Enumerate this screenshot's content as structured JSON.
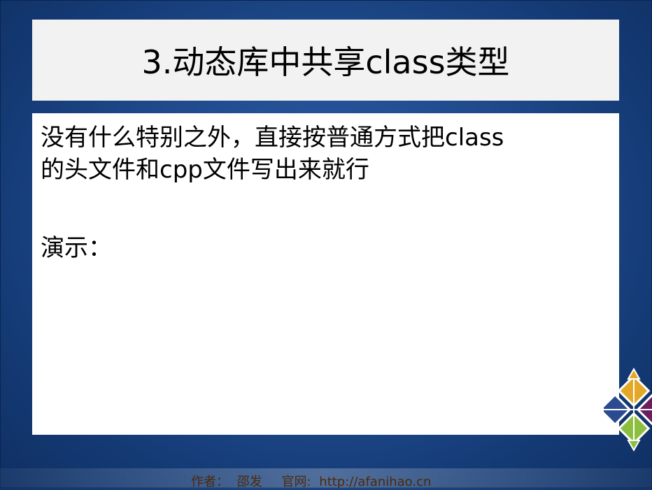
{
  "slide": {
    "title": "3.动态库中共享class类型",
    "body_line1": "没有什么特别之外，直接按普通方式把class",
    "body_line2": "的头文件和cpp文件写出来就行",
    "demo_label": "演示："
  },
  "footer": {
    "author_label": "作者：",
    "author_name": "邵发",
    "site_label": "官网:",
    "site_url": "http://afanihao.cn"
  },
  "colors": {
    "background": "#1f4a8c",
    "title_bg": "#f2f2f2",
    "content_bg": "#ffffff",
    "footer_text": "#4a2a0a"
  },
  "icons": {
    "corner_logo": "centos-logo-icon"
  }
}
